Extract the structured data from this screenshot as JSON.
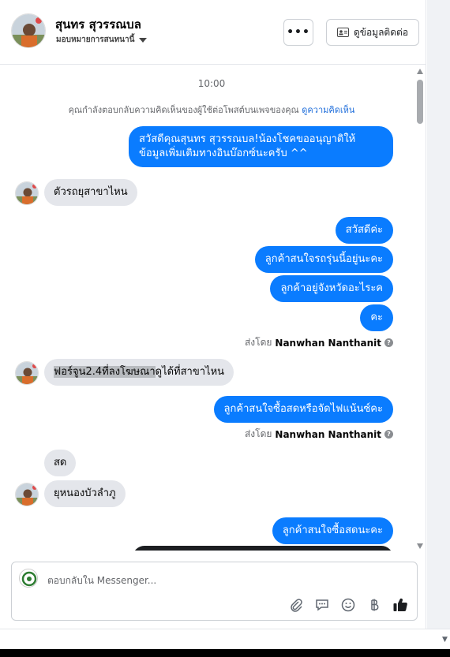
{
  "header": {
    "contact_name": "สุนทร สุวรรณบล",
    "assigned_label": "มอบหมายการสนทนานี้",
    "more_label": "•••",
    "contact_info_label": "ดูข้อมูลติดต่อ"
  },
  "chat": {
    "time": "10:00",
    "notice_text": "คุณกำลังตอบกลับความคิดเห็นของผู้ใช้ต่อโพสต์บนเพจของคุณ",
    "notice_link": "ดูความคิดเห็น",
    "msg1_line1": "สวัสดีคุณสุนทร สุวรรณบล!น้องโชคขออนุญาติให้",
    "msg1_line2": "ข้อมูลเพิ่มเติมทางอินบ๊อกซ์นะครับ ^^",
    "msg2": "ตัวรถยุสาขาไหน",
    "msg3": "สวัสดีค่ะ",
    "msg4": "ลูกค้าสนใจรถรุ่นนี้อยู่นะคะ",
    "msg5": "ลูกค้าอยู่จังหวัดอะไระค",
    "msg6": "คะ",
    "sent_by_prefix": "ส่งโดย",
    "sender_name": "Nanwhan Nanthanit",
    "msg7_highlight": "ฟอร์จูน2.4ที่ลงโฆษณา",
    "msg7_rest": "ดูได้ที่สาขาไหน",
    "msg8": "ลูกค้าสนใจซื้อสดหรือจัดไฟแน้นซ์คะ",
    "msg9": "สด",
    "msg10": "ยุหนองบัวลำภู",
    "msg11": "ลูกค้าสนใจซื้อสดนะคะ"
  },
  "composer": {
    "placeholder": "ตอบกลับใน Messenger..."
  },
  "icons": [
    "more-icon",
    "contact-card-icon",
    "attach-icon",
    "saved-reply-icon",
    "emoji-icon",
    "baht-icon",
    "thumbs-up-icon"
  ],
  "colors": {
    "outgoing_bubble": "#0a7cff",
    "incoming_bubble": "#e4e6eb",
    "link": "#216fdb"
  }
}
